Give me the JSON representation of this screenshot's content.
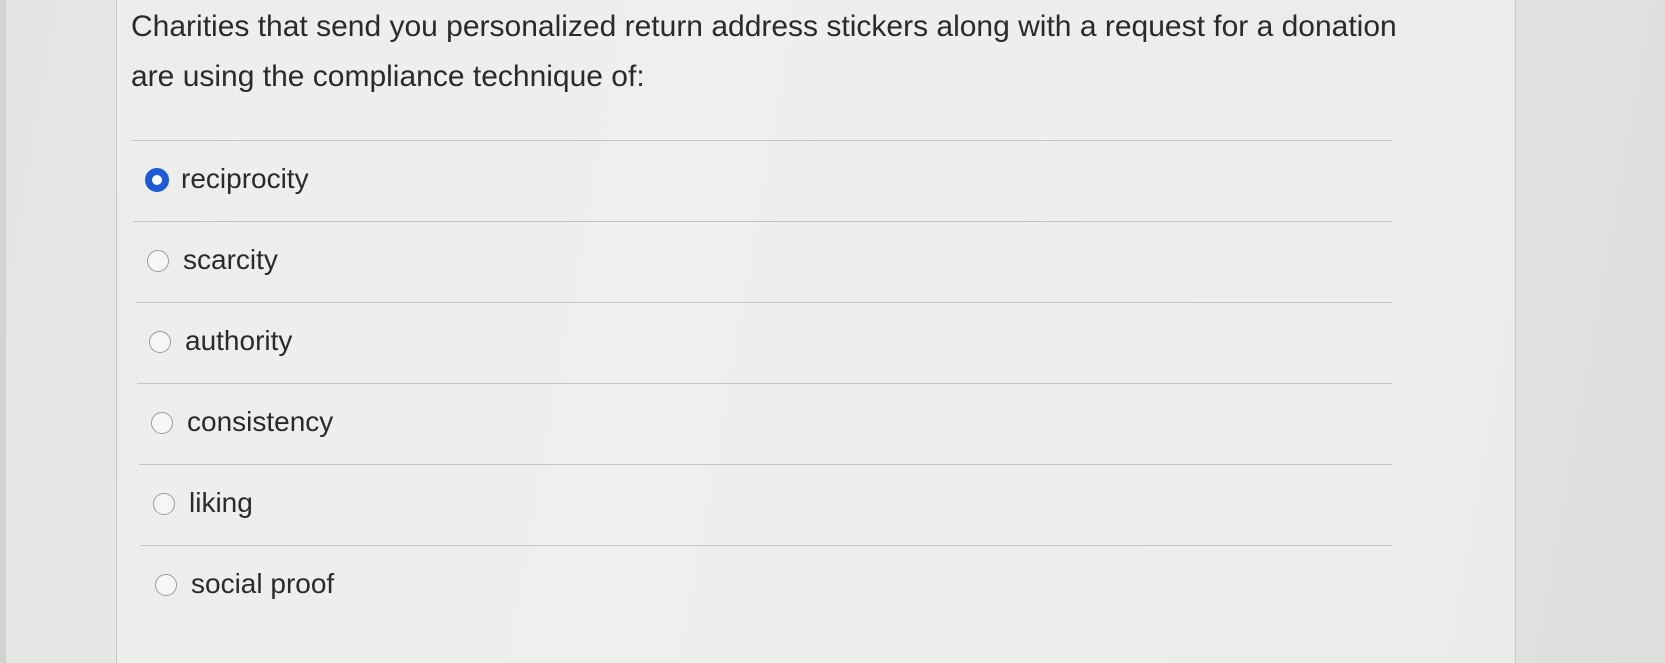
{
  "question": {
    "text": "Charities that send you personalized return address stickers along with a request for a donation are using the compliance technique of:"
  },
  "answers": [
    {
      "label": "reciprocity",
      "selected": true
    },
    {
      "label": "scarcity",
      "selected": false
    },
    {
      "label": "authority",
      "selected": false
    },
    {
      "label": "consistency",
      "selected": false
    },
    {
      "label": "liking",
      "selected": false
    },
    {
      "label": "social proof",
      "selected": false
    }
  ],
  "colors": {
    "selected_radio": "#1d5bd6",
    "text": "#2a2a2a",
    "divider": "#c4c4c2"
  }
}
